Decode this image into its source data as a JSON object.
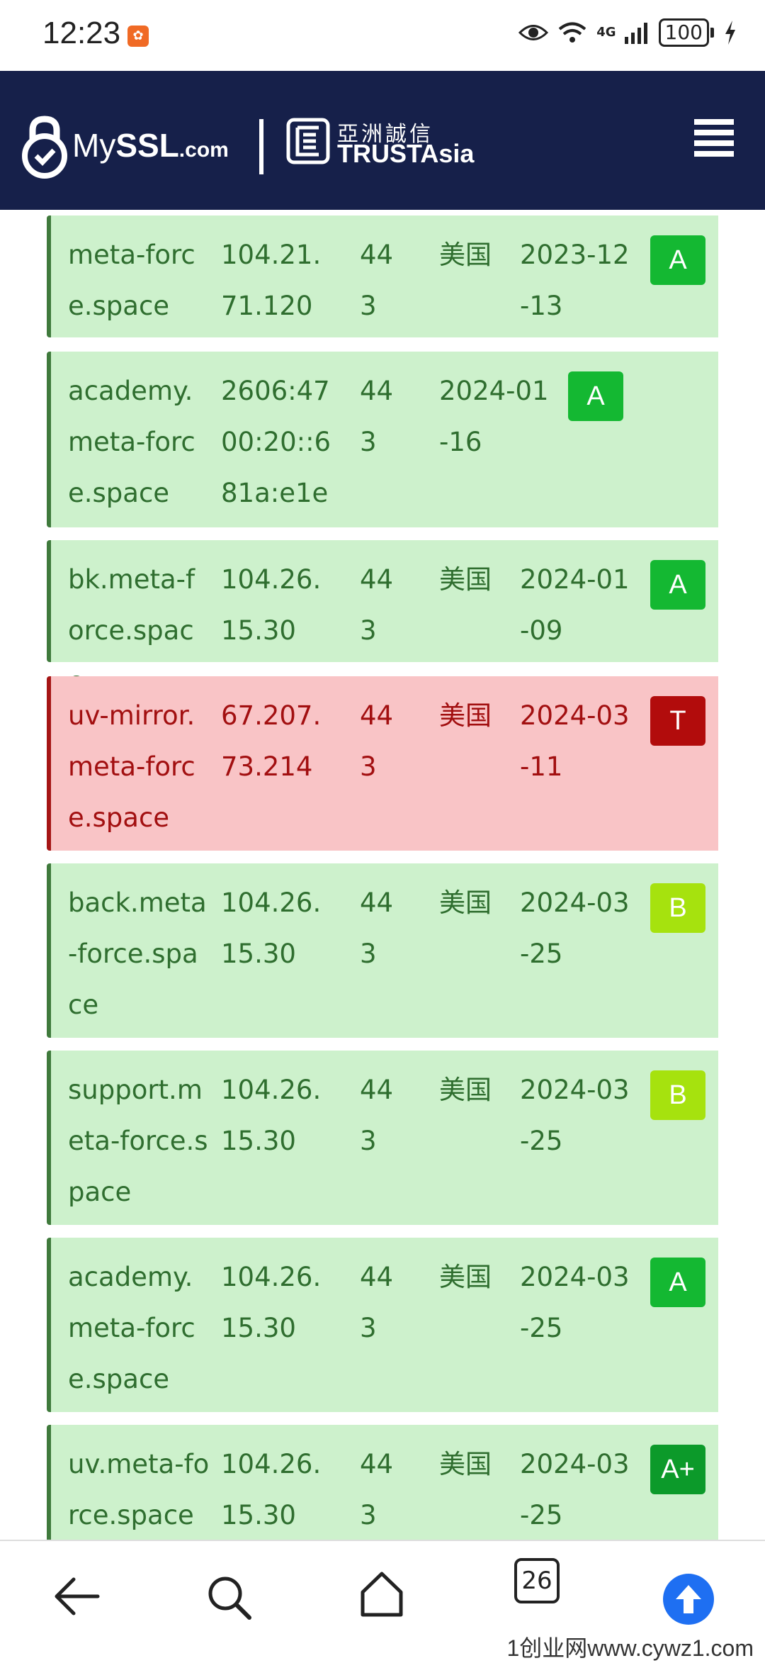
{
  "status_bar": {
    "time": "12:23",
    "network": "4G",
    "battery": "100",
    "icons": [
      "eye-icon",
      "wifi-icon",
      "signal-icon",
      "battery-icon",
      "charging-icon"
    ]
  },
  "header": {
    "brand": {
      "my": "My",
      "ssl": "SSL",
      "dom": ".com"
    },
    "partner_cn": "亞洲誠信",
    "partner_en": "TRUSTAsia",
    "menu_icon": "hamburger-menu-icon"
  },
  "colors": {
    "header_bg": "#16204a",
    "row_ok_bg": "#cdf1cc",
    "row_bad_bg": "#f9c4c6",
    "grade_A": "#14b832",
    "grade_A_plus": "#0c9a2a",
    "grade_B": "#a6e20e",
    "grade_T": "#b20c0c",
    "up_button": "#1e6ff2"
  },
  "rows": [
    {
      "host": "meta-force.space",
      "ip": "104.21.71.120",
      "port": "443",
      "country": "美国",
      "date": "2023-12-13",
      "grade": "A",
      "status": "ok"
    },
    {
      "host": "academy.meta-force.space",
      "ip": "2606:4700:20::681a:e1e",
      "port": "443",
      "country": "",
      "date": "2024-01-16",
      "grade": "A",
      "status": "ok"
    },
    {
      "host": "bk.meta-force.space",
      "ip": "104.26.15.30",
      "port": "443",
      "country": "美国",
      "date": "2024-01-09",
      "grade": "A",
      "status": "ok"
    },
    {
      "host": "uv-mirror.meta-force.space",
      "ip": "67.207.73.214",
      "port": "443",
      "country": "美国",
      "date": "2024-03-11",
      "grade": "T",
      "status": "bad"
    },
    {
      "host": "back.meta-force.space",
      "ip": "104.26.15.30",
      "port": "443",
      "country": "美国",
      "date": "2024-03-25",
      "grade": "B",
      "status": "ok"
    },
    {
      "host": "support.meta-force.space",
      "ip": "104.26.15.30",
      "port": "443",
      "country": "美国",
      "date": "2024-03-25",
      "grade": "B",
      "status": "ok"
    },
    {
      "host": "academy.meta-force.space",
      "ip": "104.26.15.30",
      "port": "443",
      "country": "美国",
      "date": "2024-03-25",
      "grade": "A",
      "status": "ok"
    },
    {
      "host": "uv.meta-force.space",
      "ip": "104.26.15.30",
      "port": "443",
      "country": "美国",
      "date": "2024-03-25",
      "grade": "A+",
      "status": "ok"
    }
  ],
  "bottom_nav": {
    "tabs_count": "26",
    "items": [
      "back-arrow-icon",
      "search-icon",
      "home-icon",
      "tabs-icon",
      "scroll-up-icon"
    ]
  },
  "watermark": "1创业网www.cywz1.com"
}
